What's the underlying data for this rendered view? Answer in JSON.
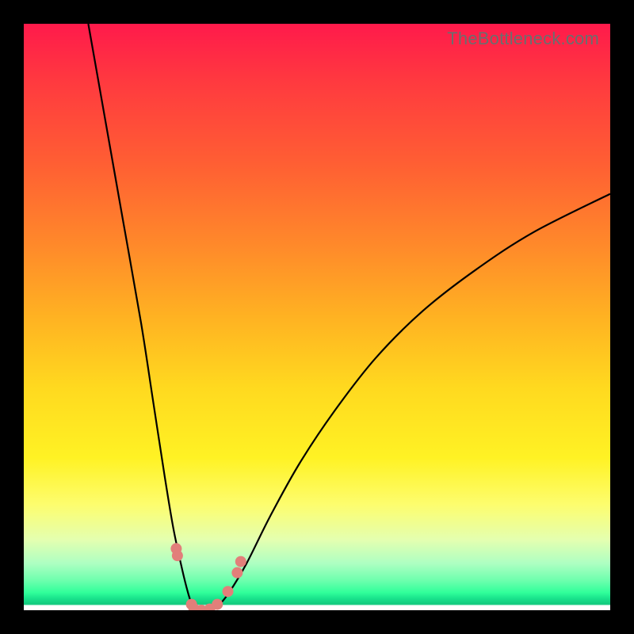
{
  "watermark": "TheBottleneck.com",
  "colors": {
    "background": "#000000",
    "gradient_top": "#ff1a4b",
    "gradient_mid_upper": "#ff8a2a",
    "gradient_mid": "#ffd91f",
    "gradient_lower": "#e4ffb0",
    "gradient_bottom": "#19e38c",
    "curve": "#000000",
    "markers": "#e27f7a"
  },
  "chart_data": {
    "type": "line",
    "title": "",
    "xlabel": "",
    "ylabel": "",
    "xlim": [
      0,
      100
    ],
    "ylim": [
      0,
      100
    ],
    "series": [
      {
        "name": "left-branch",
        "x": [
          11,
          14,
          17,
          20,
          22,
          24,
          25.5,
          27,
          28,
          28.8
        ],
        "y": [
          100,
          83,
          66,
          49,
          36,
          23,
          14,
          7,
          3,
          0.5
        ]
      },
      {
        "name": "valley",
        "x": [
          28.8,
          30,
          31.5,
          33
        ],
        "y": [
          0.5,
          0,
          0,
          0.5
        ]
      },
      {
        "name": "right-branch",
        "x": [
          33,
          35,
          38,
          42,
          47,
          53,
          60,
          68,
          77,
          87,
          100
        ],
        "y": [
          0.5,
          3,
          8,
          16,
          25,
          34,
          43,
          51,
          58,
          64.5,
          71
        ]
      }
    ],
    "markers": [
      {
        "x": 26.0,
        "y": 10.5
      },
      {
        "x": 26.2,
        "y": 9.3
      },
      {
        "x": 28.6,
        "y": 1.0
      },
      {
        "x": 29.0,
        "y": 0.3
      },
      {
        "x": 30.3,
        "y": 0.0
      },
      {
        "x": 31.7,
        "y": 0.2
      },
      {
        "x": 33.0,
        "y": 1.0
      },
      {
        "x": 34.8,
        "y": 3.2
      },
      {
        "x": 36.4,
        "y": 6.4
      },
      {
        "x": 37.0,
        "y": 8.3
      }
    ]
  }
}
